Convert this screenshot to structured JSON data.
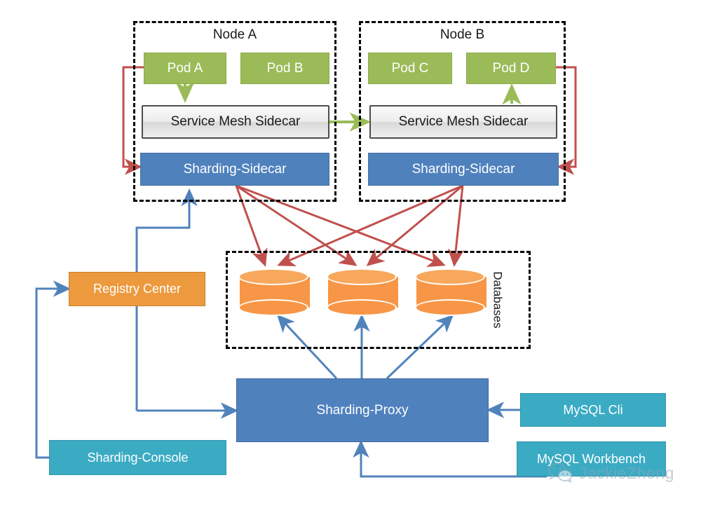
{
  "nodes": [
    {
      "title": "Node A",
      "pods": [
        "Pod A",
        "Pod B"
      ],
      "mesh": "Service Mesh Sidecar",
      "sidecar": "Sharding-Sidecar"
    },
    {
      "title": "Node B",
      "pods": [
        "Pod C",
        "Pod D"
      ],
      "mesh": "Service Mesh Sidecar",
      "sidecar": "Sharding-Sidecar"
    }
  ],
  "databases": {
    "label": "Databases",
    "items": [
      "database-cylinder-1",
      "database-cylinder-2",
      "database-cylinder-3"
    ]
  },
  "registry": {
    "label": "Registry Center"
  },
  "proxy": {
    "label": "Sharding-Proxy"
  },
  "console": {
    "label": "Sharding-Console"
  },
  "clients": [
    {
      "label": "MySQL Cli"
    },
    {
      "label": "MySQL Workbench"
    }
  ],
  "watermark": {
    "text": "JackieZheng",
    "icon": "wechat-icon"
  },
  "colors": {
    "pod_green": "#9BBB59",
    "sidecar_blue": "#4F81BD",
    "registry_orange": "#ED9A3E",
    "client_teal": "#3BABC4",
    "database_orange": "#F79646",
    "red_arrow": "#C0504D",
    "blue_arrow": "#4F81BD",
    "green_arrow": "#9BBB59",
    "dashed_border": "#000000"
  }
}
